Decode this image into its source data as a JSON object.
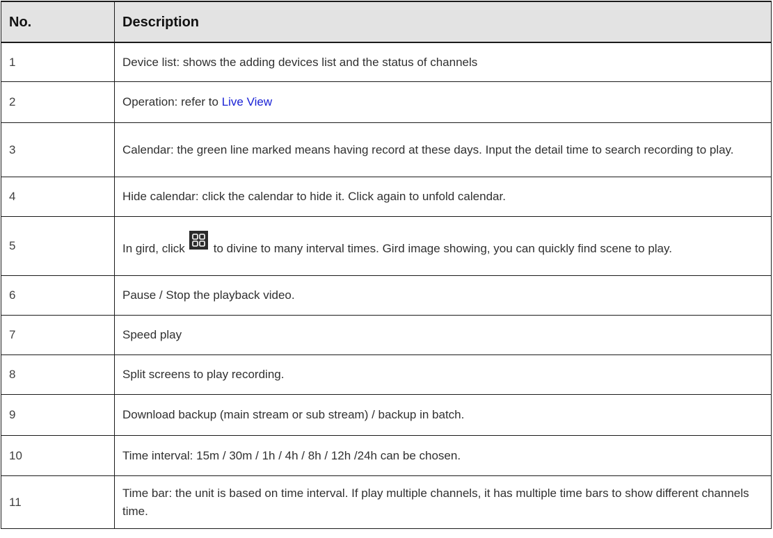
{
  "table": {
    "headers": {
      "number": "No.",
      "description": "Description"
    },
    "rows": [
      {
        "no": "1",
        "text": "Device list: shows the adding devices list and the status of channels"
      },
      {
        "no": "2",
        "text_before_link": "Operation: refer to ",
        "link": "Live View"
      },
      {
        "no": "3",
        "text": "Calendar: the green line marked means having record at these days. Input the detail time to search recording to play."
      },
      {
        "no": "4",
        "text": "Hide calendar: click the calendar to hide it. Click again to unfold calendar."
      },
      {
        "no": "5",
        "text_before_icon": "In gird, click",
        "icon": "grid-view-icon",
        "text_after_icon": "to divine to many interval times. Gird image showing, you can quickly find scene to play."
      },
      {
        "no": "6",
        "text": "Pause / Stop the playback video."
      },
      {
        "no": "7",
        "text": "Speed play"
      },
      {
        "no": "8",
        "text": "Split screens to play recording."
      },
      {
        "no": "9",
        "text": "Download backup (main stream or sub stream) / backup in batch."
      },
      {
        "no": "10",
        "text": "Time interval: 15m / 30m / 1h / 4h / 8h / 12h /24h can be chosen."
      },
      {
        "no": "11",
        "text": "Time bar: the unit is based on time interval. If play multiple channels, it has multiple time bars to show different channels time."
      }
    ]
  },
  "colors": {
    "header_bg": "#e3e3e3",
    "link": "#1a22d6",
    "border": "#1a1a1a"
  }
}
